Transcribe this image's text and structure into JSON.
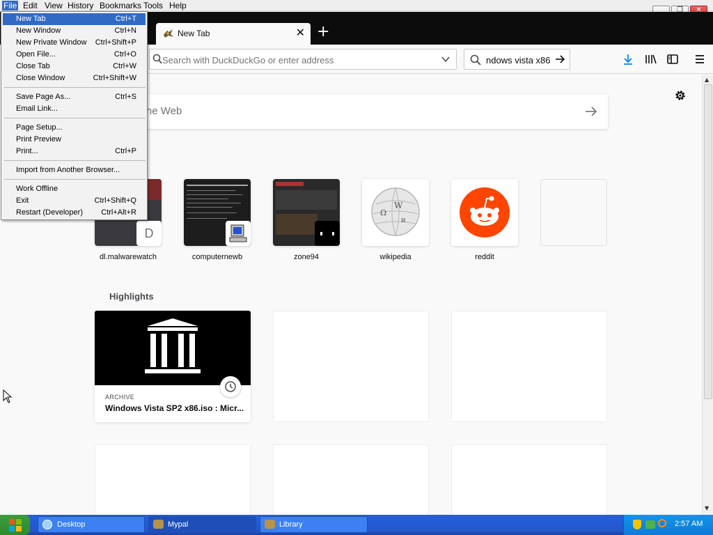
{
  "menubar": {
    "items": [
      "File",
      "Edit",
      "View",
      "History",
      "Bookmarks",
      "Tools",
      "Help"
    ]
  },
  "tab": {
    "title": "New Tab"
  },
  "navbar": {
    "url_placeholder": "Search with DuckDuckGo or enter address",
    "search_value": "ndows vista x86"
  },
  "content": {
    "search_placeholder": "Search the Web",
    "top_sites": [
      {
        "label": "dl.malwarewatch",
        "badge": "D"
      },
      {
        "label": "computernewb"
      },
      {
        "label": "zone94"
      },
      {
        "label": "wikipedia"
      },
      {
        "label": "reddit"
      }
    ],
    "highlights": {
      "title": "Highlights",
      "cards": [
        {
          "context": "ARCHIVE",
          "title": "Windows Vista SP2 x86.iso : Micr..."
        }
      ]
    }
  },
  "file_menu": {
    "items": [
      {
        "label": "New Tab",
        "shortcut": "Ctrl+T"
      },
      {
        "label": "New Window",
        "shortcut": "Ctrl+N"
      },
      {
        "label": "New Private Window",
        "shortcut": "Ctrl+Shift+P"
      },
      {
        "label": "Open File...",
        "shortcut": "Ctrl+O"
      },
      {
        "label": "Close Tab",
        "shortcut": "Ctrl+W"
      },
      {
        "label": "Close Window",
        "shortcut": "Ctrl+Shift+W"
      },
      {
        "label": "Save Page As...",
        "shortcut": "Ctrl+S"
      },
      {
        "label": "Email Link...",
        "shortcut": ""
      },
      {
        "label": "Page Setup...",
        "shortcut": ""
      },
      {
        "label": "Print Preview",
        "shortcut": ""
      },
      {
        "label": "Print...",
        "shortcut": "Ctrl+P"
      },
      {
        "label": "Import from Another Browser...",
        "shortcut": ""
      },
      {
        "label": "Work Offline",
        "shortcut": ""
      },
      {
        "label": "Exit",
        "shortcut": "Ctrl+Shift+Q"
      },
      {
        "label": "Restart (Developer)",
        "shortcut": "Ctrl+Alt+R"
      }
    ]
  },
  "taskbar": {
    "buttons": [
      "Desktop",
      "Mypal",
      "Library"
    ],
    "clock": "2:57 AM"
  },
  "colors": {
    "accent": "#316ac5",
    "download_blue": "#0a84ff",
    "reddit": "#ff4500",
    "taskbar": "#245edb"
  }
}
